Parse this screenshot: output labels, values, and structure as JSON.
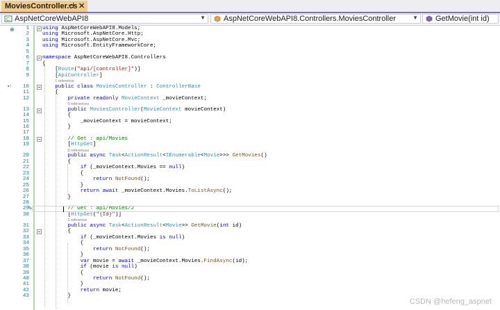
{
  "tab": {
    "title": "MoviesController.cs",
    "pin": "⊣",
    "close": "✕"
  },
  "nav": {
    "project": "AspNetCoreWebAPI8",
    "class": "AspNetCoreWebAPI8.Controllers.MoviesController",
    "member": "GetMovie(int id)"
  },
  "lines": [
    {
      "n": "1",
      "html": "<span class=\"kw\">using</span> AspNetCoreWebAPI8.Models;"
    },
    {
      "n": "2",
      "html": "<span class=\"kw\">using</span> Microsoft.AspNetCore.Http;"
    },
    {
      "n": "3",
      "html": "<span class=\"kw\">using</span> Microsoft.AspNetCore.Mvc;"
    },
    {
      "n": "4",
      "html": "<span class=\"kw\">using</span> Microsoft.EntityFrameworkCore;"
    },
    {
      "n": "5",
      "html": ""
    },
    {
      "n": "6",
      "html": "<span class=\"kw\">namespace</span> AspNetCoreWebAPI8.Controllers"
    },
    {
      "n": "7",
      "html": "{"
    },
    {
      "n": "8",
      "html": "    [<span class=\"ty\">Route</span>(<span class=\"st\">\"api/[controller]\"</span>)]"
    },
    {
      "n": "9",
      "html": "    [<span class=\"ty\">ApiController</span>]"
    },
    {
      "ref": "1 reference",
      "indent": "    "
    },
    {
      "n": "10",
      "html": "    <span class=\"kw\">public class</span> <span class=\"ty\">MoviesController</span> : <span class=\"ty\">ControllerBase</span>"
    },
    {
      "n": "11",
      "html": "    {"
    },
    {
      "n": "12",
      "html": "        <span class=\"kw\">private readonly</span> <span class=\"ty\">MovieContext</span> _movieContext;"
    },
    {
      "ref": "0 references",
      "indent": "        "
    },
    {
      "n": "13",
      "html": "        <span class=\"kw\">public</span> <span class=\"ty\">MoviesController</span>(<span class=\"ty\">MovieContext</span> movieContext)"
    },
    {
      "n": "14",
      "html": "        {"
    },
    {
      "n": "15",
      "html": "            _movieContext = movieContext;"
    },
    {
      "n": "16",
      "html": "        }"
    },
    {
      "n": "17",
      "html": ""
    },
    {
      "n": "18",
      "html": "        <span class=\"cm\">// Get : api/Movies</span>"
    },
    {
      "n": "19",
      "html": "        [<span class=\"ty\">HttpGet</span>]"
    },
    {
      "ref": "0 references",
      "indent": "        "
    },
    {
      "n": "20",
      "html": "        <span class=\"kw\">public async</span> <span class=\"ty\">Task</span>&lt;<span class=\"ty\">ActionResult</span>&lt;<span class=\"ty\">IEnumerable</span>&lt;<span class=\"ty\">Movie</span>&gt;&gt;&gt; <span class=\"mt\">GetMovies</span>()"
    },
    {
      "n": "21",
      "html": "        {"
    },
    {
      "n": "22",
      "html": "            <span class=\"kw\">if</span> (_movieContext.Movies == <span class=\"kw\">null</span>)"
    },
    {
      "n": "23",
      "html": "            {"
    },
    {
      "n": "24",
      "html": "                <span class=\"kw\">return</span> <span class=\"mt\">NotFound</span>();"
    },
    {
      "n": "25",
      "html": "            }"
    },
    {
      "n": "26",
      "html": "            <span class=\"kw\">return await</span> _movieContext.Movies.<span class=\"mt\">ToListAsync</span>();"
    },
    {
      "n": "27",
      "html": "        }"
    },
    {
      "n": "28",
      "html": ""
    },
    {
      "n": "29",
      "html": "        <span class=\"cm\">// Get : api/Movies/2</span>"
    },
    {
      "n": "30",
      "html": "        [<span class=\"ty\">HttpGet</span>(<span class=\"st\">\"{Id}\"</span>)]"
    },
    {
      "ref": "1 reference",
      "indent": "        "
    },
    {
      "n": "31",
      "html": "        <span class=\"kw\">public async</span> <span class=\"ty\">Task</span>&lt;<span class=\"ty\">ActionResult</span>&lt;<span class=\"ty\">Movie</span>&gt;&gt; <span class=\"mt\">GetMovie</span>(<span class=\"kw\">int</span> id)"
    },
    {
      "n": "32",
      "html": "        {"
    },
    {
      "n": "33",
      "html": "            <span class=\"kw\">if</span> (_movieContext.Movies <span class=\"kw\">is null</span>)"
    },
    {
      "n": "34",
      "html": "            {"
    },
    {
      "n": "35",
      "html": "                <span class=\"kw\">return</span> <span class=\"mt\">NotFound</span>();"
    },
    {
      "n": "36",
      "html": "            }"
    },
    {
      "n": "37",
      "html": "            <span class=\"kw\">var</span> movie = <span class=\"kw\">await</span> _movieContext.Movies.<span class=\"mt\">FindAsync</span>(id);"
    },
    {
      "n": "38",
      "html": "            <span class=\"kw\">if</span> (movie <span class=\"kw\">is null</span>)"
    },
    {
      "n": "39",
      "html": "            {"
    },
    {
      "n": "40",
      "html": "                <span class=\"kw\">return</span> <span class=\"mt\">NotFound</span>();"
    },
    {
      "n": "41",
      "html": "            }"
    },
    {
      "n": "42",
      "html": "            <span class=\"kw\">return</span> movie;"
    },
    {
      "n": "43",
      "html": "        }"
    }
  ],
  "watermark": "CSDN @hefeng_aspnet",
  "colors": {
    "tab_active": "#f5cc84",
    "accent": "#7a6fbf",
    "line_number": "#237893"
  }
}
